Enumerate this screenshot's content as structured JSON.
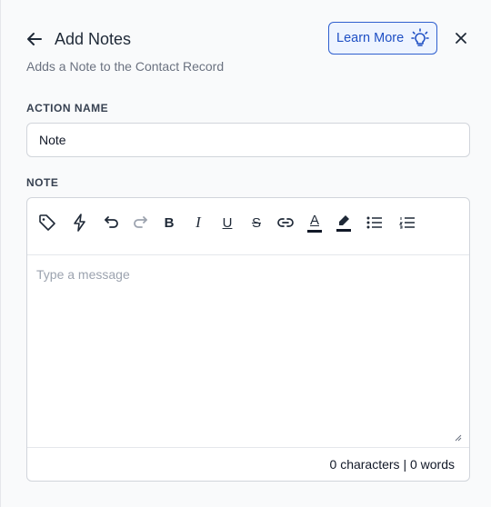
{
  "header": {
    "title": "Add Notes",
    "learn_more_label": "Learn More",
    "subtitle": "Adds a Note to the Contact Record"
  },
  "action_name": {
    "label": "ACTION NAME",
    "value": "Note"
  },
  "note": {
    "label": "NOTE",
    "placeholder": "Type a message",
    "counter": "0 characters | 0 words"
  },
  "toolbar": {
    "bold": "B",
    "italic": "I",
    "underline": "U",
    "strike": "S",
    "text_color": "A"
  },
  "colors": {
    "accent": "#2f5fcf",
    "accent_bg": "#eef4ff"
  }
}
